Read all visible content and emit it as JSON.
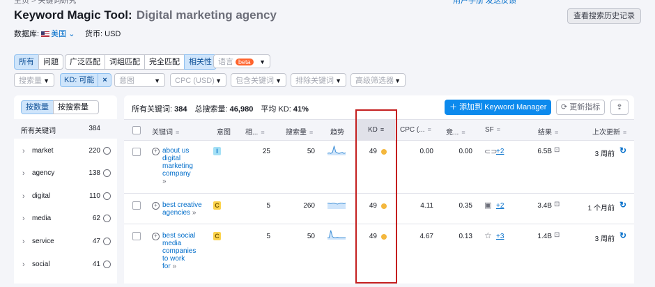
{
  "header": {
    "breadcrumb": "主页 > 关键词研究",
    "top_right_link": "用户手册  发送反馈",
    "title": "Keyword Magic Tool:",
    "subtitle": "Digital marketing agency",
    "history_button": "查看搜索历史记录",
    "database_label": "数据库:",
    "database_value": "美国",
    "currency_label": "货币:",
    "currency_value": "USD"
  },
  "match_tabs": [
    {
      "label": "所有",
      "active": true
    },
    {
      "label": "问题",
      "active": false
    },
    {
      "label": "广泛匹配",
      "active": false
    },
    {
      "label": "词组匹配",
      "active": false
    },
    {
      "label": "完全匹配",
      "active": false
    },
    {
      "label": "相关性",
      "active": true
    }
  ],
  "language_dropdown": {
    "label": "语言",
    "badge": "beta"
  },
  "filters": {
    "volume": "搜索量",
    "kd": "KD: 可能",
    "kd_clear": "×",
    "intent": "意图",
    "cpc": "CPC (USD)",
    "include": "包含关键词",
    "exclude": "排除关键词",
    "advanced": "高级筛选器"
  },
  "left_panel": {
    "toggle_count": "按数量",
    "toggle_volume": "按搜索量",
    "all_keywords_label": "所有关键词",
    "all_keywords_count": "384",
    "groups": [
      {
        "keyword": "market",
        "count": "220"
      },
      {
        "keyword": "agency",
        "count": "138"
      },
      {
        "keyword": "digital",
        "count": "110"
      },
      {
        "keyword": "media",
        "count": "62"
      },
      {
        "keyword": "service",
        "count": "47"
      },
      {
        "keyword": "social",
        "count": "41"
      }
    ]
  },
  "stats": {
    "all_keywords_label": "所有关键词:",
    "all_keywords_value": "384",
    "total_volume_label": "总搜索量:",
    "total_volume_value": "46,980",
    "avg_kd_label": "平均 KD:",
    "avg_kd_value": "41%"
  },
  "actions": {
    "add_button": "添加到 Keyword Manager",
    "refresh_button": "更新指标"
  },
  "columns": [
    "关键词",
    "意图",
    "相...",
    "搜索量",
    "趋势",
    "KD",
    "CPC (...",
    "竞...",
    "SF",
    "结果",
    "上次更新"
  ],
  "rows": [
    {
      "keyword_lines": [
        "about us",
        "digital",
        "marketing",
        "company"
      ],
      "intent": "I",
      "intent_color": "#a4e0f5",
      "intent_text_color": "#006dca",
      "related": "25",
      "volume": "50",
      "trend": [
        0.2,
        0.25,
        0.2,
        0.3,
        0.95,
        0.35,
        0.25,
        0.2,
        0.25,
        0.3,
        0.2,
        0.25
      ],
      "kd": "49",
      "cpc": "0.00",
      "comp": "0.00",
      "sf_icon": "link-icon",
      "sf_more": "+2",
      "results": "6.5B",
      "updated": "3 周前"
    },
    {
      "keyword_lines": [
        "best creative",
        "agencies"
      ],
      "intent": "C",
      "intent_color": "#fcd34d",
      "intent_text_color": "#7a5b00",
      "related": "5",
      "volume": "260",
      "trend": [
        0.6,
        0.6,
        0.55,
        0.6,
        0.6,
        0.55,
        0.5,
        0.55,
        0.6,
        0.6,
        0.55,
        0.6
      ],
      "kd": "49",
      "cpc": "4.11",
      "comp": "0.35",
      "sf_icon": "image-icon",
      "sf_more": "+2",
      "results": "3.4B",
      "updated": "1 个月前"
    },
    {
      "keyword_lines": [
        "best social",
        "media",
        "companies",
        "to work",
        "for"
      ],
      "intent": "C",
      "intent_color": "#fcd34d",
      "intent_text_color": "#7a5b00",
      "related": "5",
      "volume": "50",
      "trend": [
        0.2,
        0.2,
        0.95,
        0.3,
        0.2,
        0.2,
        0.25,
        0.2,
        0.2,
        0.2,
        0.2,
        0.2
      ],
      "kd": "49",
      "cpc": "4.67",
      "comp": "0.13",
      "sf_icon": "star-icon",
      "sf_more": "+3",
      "results": "1.4B",
      "updated": "3 周前"
    }
  ],
  "colors": {
    "accent": "#0d8aed",
    "highlight_box": "#c41f1f",
    "kd_dot": "#f4b73d"
  }
}
